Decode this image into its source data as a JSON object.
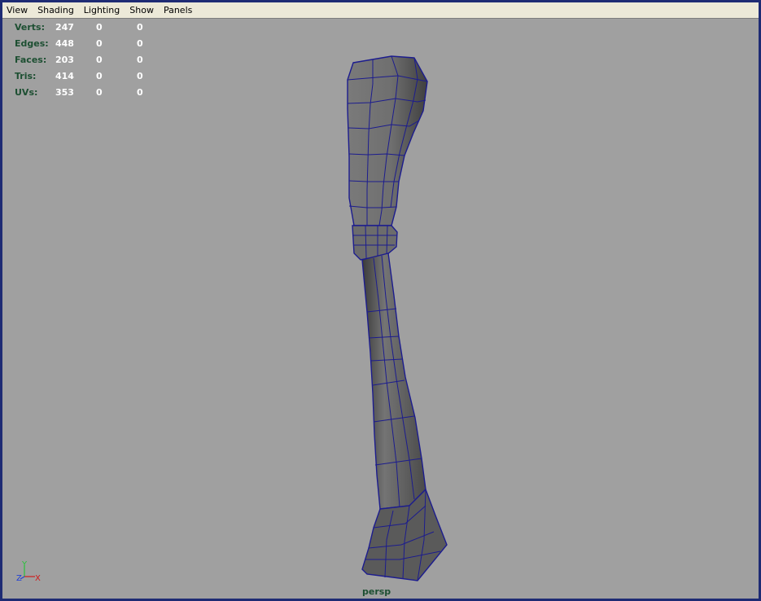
{
  "menu": {
    "items": [
      "View",
      "Shading",
      "Lighting",
      "Show",
      "Panels"
    ]
  },
  "hud": {
    "rows": [
      {
        "label": "Verts:",
        "values": [
          "247",
          "0",
          "0"
        ]
      },
      {
        "label": "Edges:",
        "values": [
          "448",
          "0",
          "0"
        ]
      },
      {
        "label": "Faces:",
        "values": [
          "203",
          "0",
          "0"
        ]
      },
      {
        "label": "Tris:",
        "values": [
          "414",
          "0",
          "0"
        ]
      },
      {
        "label": "UVs:",
        "values": [
          "353",
          "0",
          "0"
        ]
      }
    ]
  },
  "viewport": {
    "camera_label": "persp",
    "axis": {
      "y": "Y",
      "z": "Z",
      "x": "X"
    }
  },
  "colors": {
    "background": "#a0a0a0",
    "hud_label": "#1d4f32",
    "hud_value": "#ffffff",
    "wireframe": "#1c1c8e",
    "mesh_face": "#6e6e6e",
    "axis_x": "#d01a1a",
    "axis_y": "#29c23a",
    "axis_z": "#1f3fd6"
  }
}
